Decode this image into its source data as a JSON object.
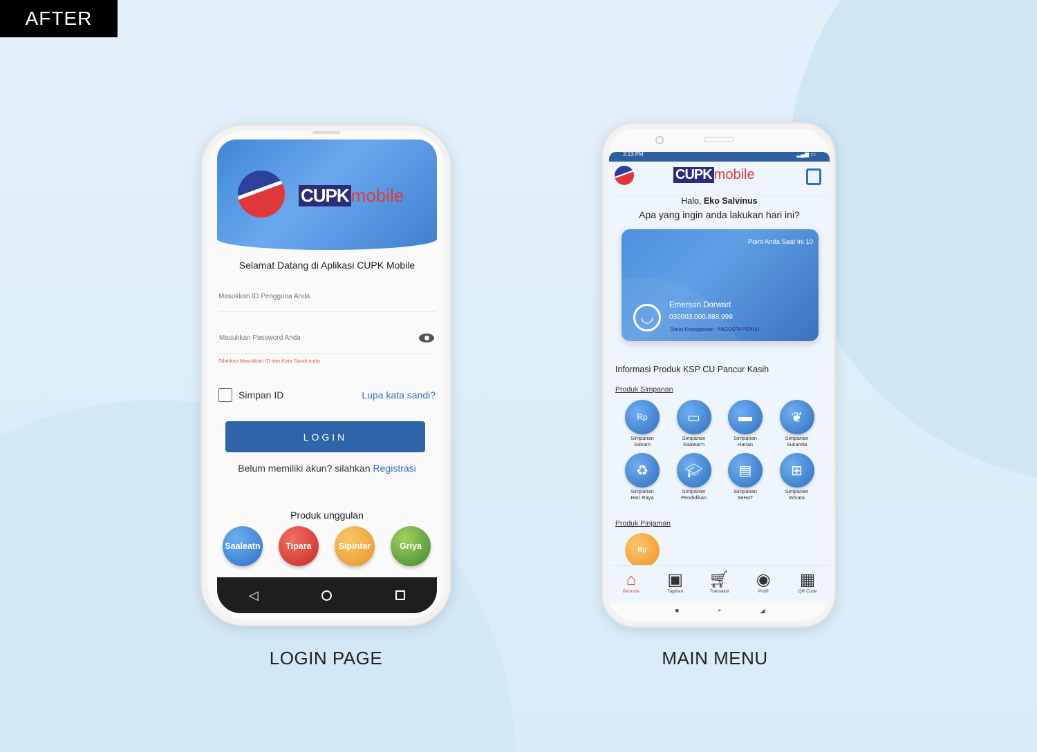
{
  "badge": "AFTER",
  "captions": {
    "login": "LOGIN PAGE",
    "main": "MAIN MENU"
  },
  "colors": {
    "primary": "#2f65a8",
    "accent_red": "#e23a3a",
    "error": "#e8554e"
  },
  "login": {
    "logo": {
      "box": "CUPK",
      "text": "mobile"
    },
    "welcome": "Selamat Datang di Aplikasi CUPK Mobile",
    "user_placeholder": "Masukkan ID Pengguna Anda",
    "password_placeholder": "Masukkan Password Anda",
    "error": "Silahkan Masukkan ID dan Kata Sandi anda",
    "remember": "Simpan ID",
    "forgot": "Lupa kata sandi?",
    "login_button": "LOGIN",
    "register_prompt": "Belum memiliki akun? silahkan",
    "register_link": "Registrasi",
    "featured_title": "Produk unggulan",
    "featured": [
      {
        "label": "Saaleatn",
        "color": "#3c83d8"
      },
      {
        "label": "Tipara",
        "color": "#d9362f"
      },
      {
        "label": "Sipintar",
        "color": "#f0a43a"
      },
      {
        "label": "Griya",
        "color": "#5aa63a"
      }
    ]
  },
  "main": {
    "status_time": "2:13 PM",
    "logo": {
      "box": "CUPK",
      "text": "mobile"
    },
    "greeting_prefix": "Halo,",
    "user_name": "Eko Salvinus",
    "question": "Apa yang ingin anda lakukan hari ini?",
    "card": {
      "points": "Point Anda Saat Ini 10",
      "name": "Emerson Dorwart",
      "number": "030003.000.888.999",
      "status": "Status Keanggotaan : ANGGOTA PENUH"
    },
    "info_title": "Informasi Produk KSP CU Pancur Kasih",
    "savings_title": "Produk Simpanan",
    "savings": [
      {
        "l1": "Simpanan",
        "l2": "Saham",
        "icon": "hands-money-icon"
      },
      {
        "l1": "Simpanan",
        "l2": "Saaleat'n",
        "icon": "cash-icon"
      },
      {
        "l1": "Simpanan",
        "l2": "Harian",
        "icon": "wallet-icon"
      },
      {
        "l1": "Simpanan",
        "l2": "Sukarela",
        "icon": "plant-money-icon"
      },
      {
        "l1": "Simpanan",
        "l2": "Hari Raya",
        "icon": "leaf-money-icon"
      },
      {
        "l1": "Simpanan",
        "l2": "Pendidikan",
        "icon": "graduation-cap-icon"
      },
      {
        "l1": "Simpanan",
        "l2": "SeHaT",
        "icon": "briefcase-icon"
      },
      {
        "l1": "Simpanan",
        "l2": "Wisata",
        "icon": "gift-icon"
      }
    ],
    "loans_title": "Produk Pinjaman",
    "nav": [
      {
        "label": "Beranda",
        "icon": "home-icon"
      },
      {
        "label": "Tagihan",
        "icon": "bill-icon"
      },
      {
        "label": "Transaksi",
        "icon": "cart-icon"
      },
      {
        "label": "Profil",
        "icon": "profile-icon"
      },
      {
        "label": "QR Code",
        "icon": "qr-code-icon"
      }
    ]
  }
}
